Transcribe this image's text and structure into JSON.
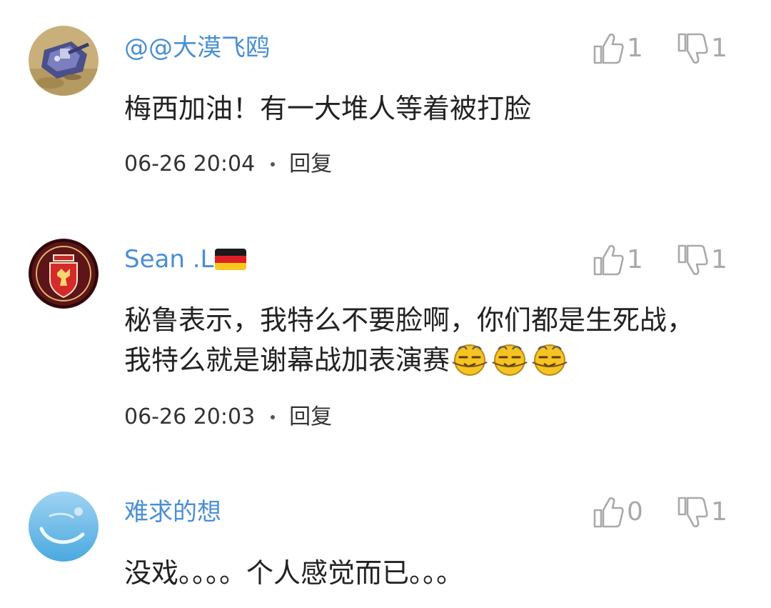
{
  "comments": [
    {
      "username": "@@大漠飞鸥",
      "avatar_icon": "rts-tank-avatar-icon",
      "likes": "1",
      "dislikes": "1",
      "text": "梅西加油！有一大堆人等着被打脸",
      "time": "06-26 20:04",
      "reply_label": "回复"
    },
    {
      "username": "Sean .L",
      "flag_icon": "germany-flag-icon",
      "avatar_icon": "manchester-united-crest-avatar-icon",
      "likes": "1",
      "dislikes": "1",
      "text": "秘鲁表示，我特么不要脸啊，你们都是生死战，我特么就是谢幕战加表演赛",
      "emojis": [
        "annoyed-face-emoji-icon",
        "annoyed-face-emoji-icon",
        "annoyed-face-emoji-icon"
      ],
      "time": "06-26 20:03",
      "reply_label": "回复"
    },
    {
      "username": "难求的想",
      "avatar_icon": "blue-sky-avatar-icon",
      "likes": "0",
      "dislikes": "1",
      "text": "没戏。。。。个人感觉而已。。。"
    }
  ],
  "colors": {
    "username": "#4a8fd4",
    "vote": "#a9a9a9",
    "text": "#222222",
    "meta": "#333333"
  }
}
